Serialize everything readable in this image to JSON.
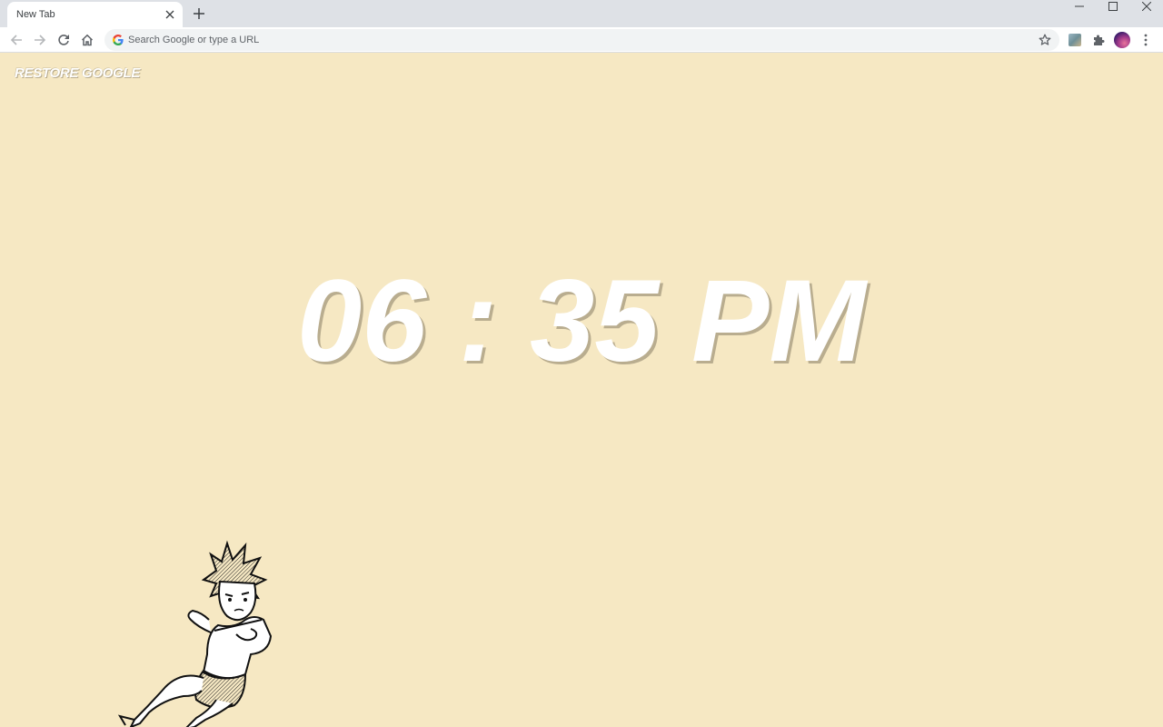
{
  "browser": {
    "tab_title": "New Tab",
    "omnibox_placeholder": "Search Google or type a URL"
  },
  "page": {
    "restore_label": "RESTORE GOOGLE",
    "clock": {
      "hours": "06",
      "separator": ":",
      "minutes": "35",
      "meridiem": "PM"
    },
    "background_color": "#f6e8c3",
    "illustration": "anime-boy-falling"
  },
  "icons": {
    "back": "back-arrow-icon",
    "forward": "forward-arrow-icon",
    "reload": "reload-icon",
    "home": "home-icon",
    "bookmark": "star-icon",
    "extension": "puzzle-icon",
    "menu": "kebab-menu-icon"
  }
}
